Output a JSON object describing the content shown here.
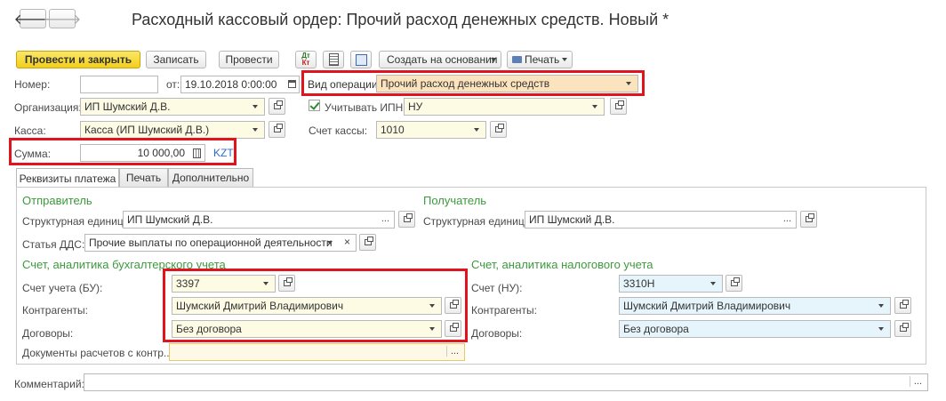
{
  "title": "Расходный кассовый ордер: Прочий расход денежных средств. Новый *",
  "nav": {
    "back_icon": "arrow-left-icon",
    "forward_icon": "arrow-right-icon"
  },
  "toolbar": {
    "post_close": "Провести и закрыть",
    "save": "Записать",
    "post": "Провести",
    "dtkt_dt": "Дт",
    "dtkt_kt": "Кт",
    "create_based": "Создать на основании",
    "print": "Печать"
  },
  "header": {
    "number_label": "Номер:",
    "number_value": "",
    "from_label": "от:",
    "date_value": "19.10.2018  0:00:00",
    "op_type_label": "Вид операции:",
    "op_type_value": "Прочий расход денежных средств",
    "org_label": "Организация:",
    "org_value": "ИП Шумский Д.В.",
    "ipn_label": "Учитывать ИПН",
    "ipn_value": "НУ",
    "cash_label": "Касса:",
    "cash_value": "Касса (ИП Шумский Д.В.)",
    "cash_account_label": "Счет кассы:",
    "cash_account_value": "1010",
    "sum_label": "Сумма:",
    "sum_value": "10 000,00",
    "currency": "KZT"
  },
  "tabs": [
    "Реквизиты платежа",
    "Печать",
    "Дополнительно"
  ],
  "sender": {
    "heading": "Отправитель",
    "unit_label": "Структурная единица:",
    "unit_value": "ИП Шумский Д.В.",
    "dds_label": "Статья ДДС:",
    "dds_value": "Прочие выплаты по операционной деятельности"
  },
  "receiver": {
    "heading": "Получатель",
    "unit_label": "Структурная единица:",
    "unit_value": "ИП Шумский Д.В."
  },
  "bu": {
    "heading": "Счет, аналитика бухгалтерского учета",
    "account_label": "Счет учета (БУ):",
    "account_value": "3397",
    "contractors_label": "Контрагенты:",
    "contractors_value": "Шумский Дмитрий Владимирович",
    "contracts_label": "Договоры:",
    "contracts_value": "Без договора",
    "docs_label": "Документы расчетов с контр...",
    "docs_value": ""
  },
  "nu": {
    "heading": "Счет, аналитика налогового учета",
    "account_label": "Счет (НУ):",
    "account_value": "3310Н",
    "contractors_label": "Контрагенты:",
    "contractors_value": "Шумский Дмитрий Владимирович",
    "contracts_label": "Договоры:",
    "contracts_value": "Без договора"
  },
  "comment": {
    "label": "Комментарий:",
    "value": ""
  },
  "colors": {
    "highlight": "#e0141c",
    "primary": "#f2cf1a",
    "section_heading": "#3c9a3c"
  }
}
